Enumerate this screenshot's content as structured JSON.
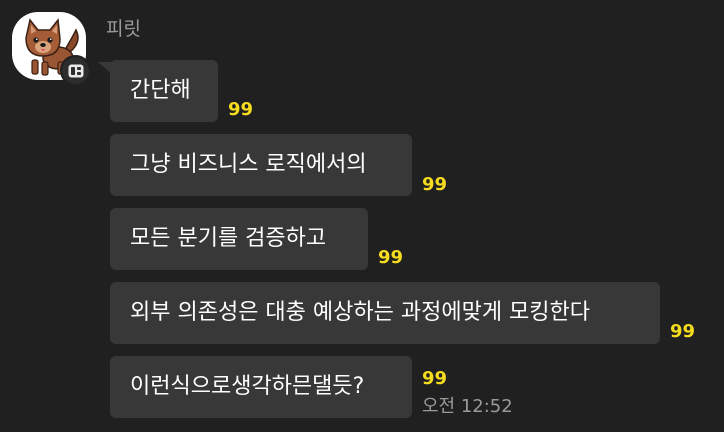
{
  "sender": {
    "name": "피릿",
    "avatar_icon": "dog-avatar-icon",
    "badge_icon": "profile-badge-icon"
  },
  "messages": [
    {
      "text": "간단해",
      "unread": "99"
    },
    {
      "text": "그냥 비즈니스 로직에서의",
      "unread": "99"
    },
    {
      "text": "모든 분기를 검증하고",
      "unread": "99"
    },
    {
      "text": "외부 의존성은 대충 예상하는 과정에맞게 모킹한다",
      "unread": "99"
    },
    {
      "text": "이런식으로생각하믄댈듯?",
      "unread": "99",
      "time": "오전 12:52"
    }
  ],
  "colors": {
    "background": "#202020",
    "bubble": "#383838",
    "unread": "#f5dc1e",
    "muted_text": "#9a9a9a"
  }
}
